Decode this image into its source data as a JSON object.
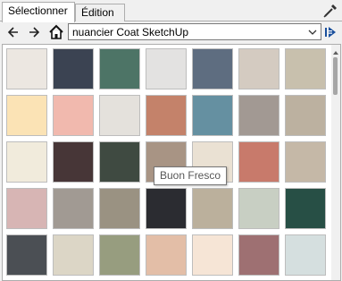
{
  "tabs": [
    {
      "label": "Sélectionner",
      "active": true
    },
    {
      "label": "Édition",
      "active": false
    }
  ],
  "toolbar": {
    "back_icon": "arrow-left-icon",
    "forward_icon": "arrow-right-icon",
    "home_icon": "home-icon",
    "eyedropper_icon": "eyedropper-icon",
    "details_icon": "details-arrow-icon"
  },
  "collection": {
    "selected": "nuancier Coat SketchUp"
  },
  "swatches": [
    [
      "#ece7e1",
      "#3b4352",
      "#4d7466",
      "#e3e2e1",
      "#5e6d80",
      "#d4cbc1",
      "#c8c0ad"
    ],
    [
      "#fbe3b5",
      "#f1b9ae",
      "#e4e1dc",
      "#c4826a",
      "#6590a1",
      "#a29993",
      "#bcb1a0"
    ],
    [
      "#f1ebdc",
      "#473637",
      "#3f4a41",
      "#a89484",
      "#eae1d3",
      "#c87a6b",
      "#c5b8a7"
    ],
    [
      "#d7b5b4",
      "#a19a93",
      "#9a9282",
      "#2b2c31",
      "#bbb09c",
      "#c8cfc3",
      "#274f45"
    ],
    [
      "#4b4f54",
      "#dcd6c6",
      "#979d7f",
      "#e3bea7",
      "#f6e5d6",
      "#9e7072",
      "#d5dfdf"
    ]
  ],
  "tooltip": "Buon Fresco"
}
